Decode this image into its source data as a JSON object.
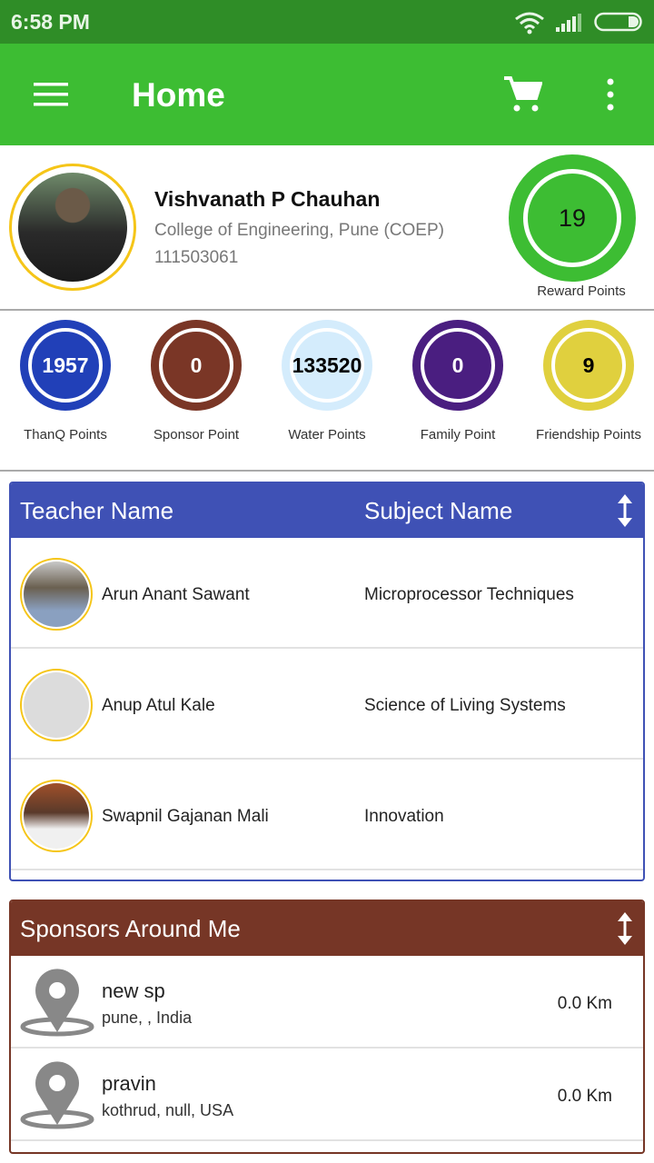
{
  "status_bar": {
    "time": "6:58 PM",
    "icons": [
      "wifi-icon",
      "signal-icon",
      "battery-icon"
    ]
  },
  "toolbar": {
    "title": "Home",
    "icons": [
      "menu-icon",
      "cart-icon",
      "more-vert-icon"
    ]
  },
  "profile": {
    "name": "Vishvanath P Chauhan",
    "college": "College of Engineering, Pune (COEP)",
    "id": "111503061",
    "reward_points": "19",
    "reward_label": "Reward Points"
  },
  "points": [
    {
      "value": "1957",
      "label": "ThanQ Points",
      "color": "#2140b8",
      "text_color": "#ffffff"
    },
    {
      "value": "0",
      "label": "Sponsor Point",
      "color": "#7a3626",
      "text_color": "#ffffff"
    },
    {
      "value": "133520",
      "label": "Water Points",
      "color": "#d4ecfc",
      "text_color": "#000000"
    },
    {
      "value": "0",
      "label": "Family Point",
      "color": "#4a1e80",
      "text_color": "#ffffff"
    },
    {
      "value": "9",
      "label": "Friendship Points",
      "color": "#e0d03e",
      "text_color": "#000000"
    }
  ],
  "teachers": {
    "header_name": "Teacher Name",
    "header_subject": "Subject Name",
    "color": "#3f51b5",
    "rows": [
      {
        "name": "Arun Anant Sawant",
        "subject": "Microprocessor Techniques"
      },
      {
        "name": "Anup Atul Kale",
        "subject": "Science of Living Systems"
      },
      {
        "name": "Swapnil Gajanan Mali",
        "subject": "Innovation"
      }
    ]
  },
  "sponsors": {
    "header": "Sponsors Around Me",
    "color": "#763626",
    "rows": [
      {
        "name": "new sp",
        "address": "pune, , India",
        "distance": "0.0 Km"
      },
      {
        "name": "pravin",
        "address": "kothrud, null, USA",
        "distance": "0.0 Km"
      }
    ]
  }
}
